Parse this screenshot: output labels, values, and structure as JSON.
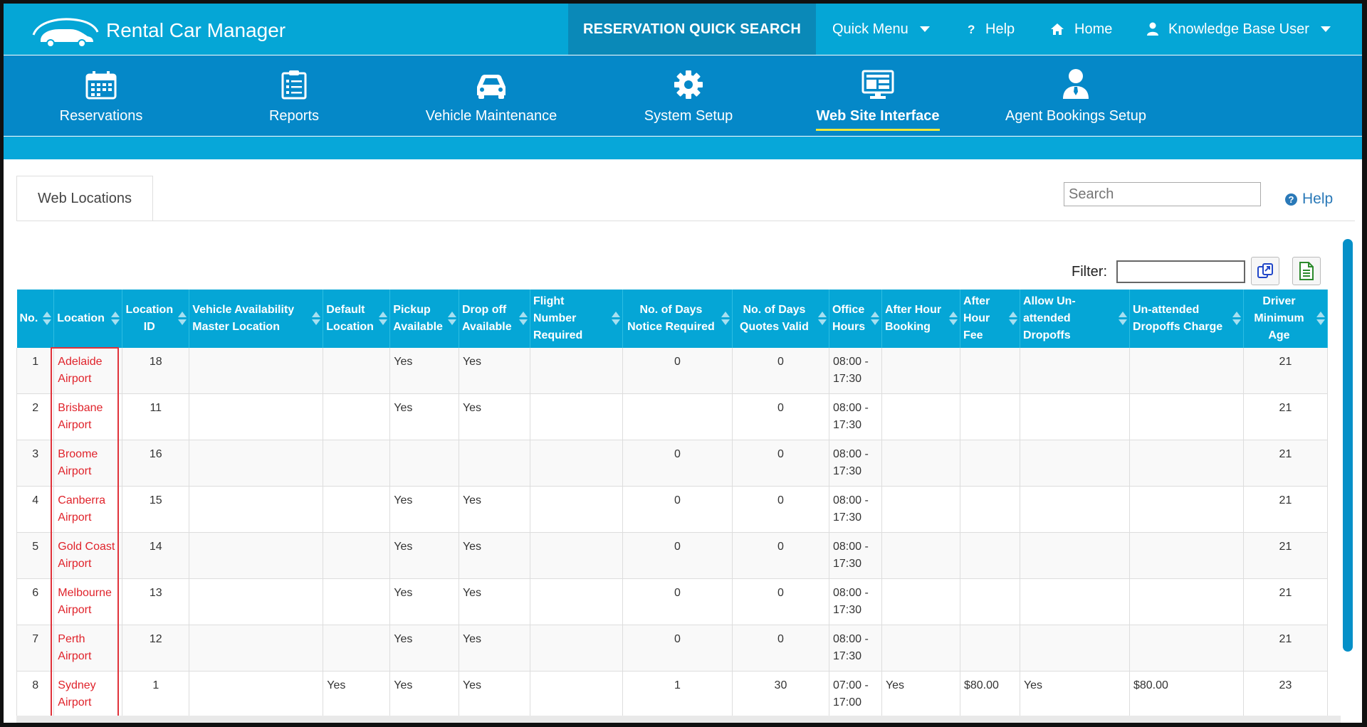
{
  "header": {
    "app_title": "Rental Car Manager",
    "quick_search": "RESERVATION QUICK SEARCH",
    "quick_menu": "Quick Menu",
    "help": "Help",
    "home": "Home",
    "user": "Knowledge Base User"
  },
  "modules": [
    {
      "label": "Reservations",
      "icon": "calendar-icon",
      "active": false
    },
    {
      "label": "Reports",
      "icon": "clipboard-list-icon",
      "active": false
    },
    {
      "label": "Vehicle Maintenance",
      "icon": "car-icon",
      "active": false
    },
    {
      "label": "System Setup",
      "icon": "gear-icon",
      "active": false
    },
    {
      "label": "Web Site Interface",
      "icon": "monitor-icon",
      "active": true
    },
    {
      "label": "Agent Bookings Setup",
      "icon": "agent-icon",
      "active": false
    }
  ],
  "page": {
    "tab": "Web Locations",
    "search_placeholder": "Search",
    "help": "Help",
    "filter_label": "Filter:"
  },
  "table": {
    "columns": [
      "No.",
      "Location",
      "Location ID",
      "Vehicle Availability Master Location",
      "Default Location",
      "Pickup Available",
      "Drop off Available",
      "Flight Number Required",
      "No. of Days Notice Required",
      "No. of Days Quotes Valid",
      "Office Hours",
      "After Hour Booking",
      "After Hour Fee",
      "Allow Un-attended Dropoffs",
      "Un-attended Dropoffs Charge",
      "Driver Minimum Age"
    ],
    "rows": [
      [
        "1",
        "Adelaide Airport",
        "18",
        "",
        "",
        "Yes",
        "Yes",
        "",
        "0",
        "0",
        "08:00 - 17:30",
        "",
        "",
        "",
        "",
        "21"
      ],
      [
        "2",
        "Brisbane Airport",
        "11",
        "",
        "",
        "Yes",
        "Yes",
        "",
        "",
        "0",
        "08:00 - 17:30",
        "",
        "",
        "",
        "",
        "21"
      ],
      [
        "3",
        "Broome Airport",
        "16",
        "",
        "",
        "",
        "",
        "",
        "0",
        "0",
        "08:00 - 17:30",
        "",
        "",
        "",
        "",
        "21"
      ],
      [
        "4",
        "Canberra Airport",
        "15",
        "",
        "",
        "Yes",
        "Yes",
        "",
        "0",
        "0",
        "08:00 - 17:30",
        "",
        "",
        "",
        "",
        "21"
      ],
      [
        "5",
        "Gold Coast Airport",
        "14",
        "",
        "",
        "Yes",
        "Yes",
        "",
        "0",
        "0",
        "08:00 - 17:30",
        "",
        "",
        "",
        "",
        "21"
      ],
      [
        "6",
        "Melbourne Airport",
        "13",
        "",
        "",
        "Yes",
        "Yes",
        "",
        "0",
        "0",
        "08:00 - 17:30",
        "",
        "",
        "",
        "",
        "21"
      ],
      [
        "7",
        "Perth Airport",
        "12",
        "",
        "",
        "Yes",
        "Yes",
        "",
        "0",
        "0",
        "08:00 - 17:30",
        "",
        "",
        "",
        "",
        "21"
      ],
      [
        "8",
        "Sydney Airport",
        "1",
        "",
        "Yes",
        "Yes",
        "Yes",
        "",
        "1",
        "30",
        "07:00 - 17:00",
        "Yes",
        "$80.00",
        "Yes",
        "$80.00",
        "23"
      ]
    ]
  },
  "colors": {
    "topbar": "#05a6d6",
    "modnav": "#0588c8",
    "quick_search_bg": "#0a89b8",
    "link": "#e0232b",
    "active_underline": "#f1e93a"
  }
}
